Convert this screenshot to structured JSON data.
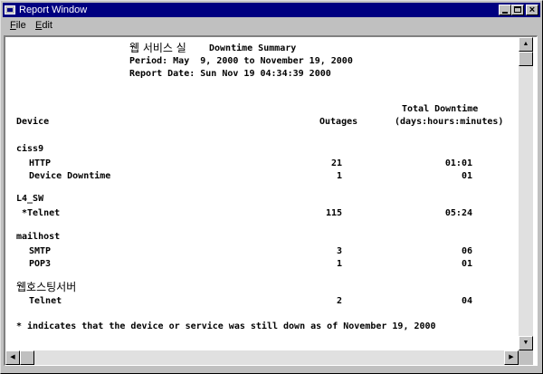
{
  "window": {
    "title": "Report Window"
  },
  "menu": {
    "file": "File",
    "edit": "Edit",
    "file_accel": "F",
    "edit_accel": "E"
  },
  "report": {
    "service_name": "웹 서비스 실",
    "summary_title": "Downtime Summary",
    "period": "Period: May  9, 2000 to November 19, 2000",
    "report_date": "Report Date: Sun Nov 19 04:34:39 2000",
    "header_total": "Total Downtime",
    "header_device": "Device",
    "header_outages": "Outages",
    "header_format": "(days:hours:minutes)",
    "footnote": "* indicates that the device or service was still down as of November 19, 2000",
    "groups": [
      {
        "device": "ciss9",
        "rows": [
          {
            "name": "HTTP",
            "outages": "21",
            "downtime": "01:01"
          },
          {
            "name": "Device Downtime",
            "outages": "1",
            "downtime": "01"
          }
        ]
      },
      {
        "device": "L4_SW",
        "rows": [
          {
            "name": "*Telnet",
            "outages": "115",
            "downtime": "05:24"
          }
        ]
      },
      {
        "device": "mailhost",
        "rows": [
          {
            "name": "SMTP",
            "outages": "3",
            "downtime": "06"
          },
          {
            "name": "POP3",
            "outages": "1",
            "downtime": "01"
          }
        ]
      },
      {
        "device": "웹호스팅서버",
        "rows": [
          {
            "name": "Telnet",
            "outages": "2",
            "downtime": "04"
          }
        ]
      }
    ]
  },
  "icons": {
    "app": "report-app-icon",
    "minimize": "minimize-icon",
    "maximize": "maximize-icon",
    "close": "close-icon"
  },
  "scroll_position": {
    "vertical": 0,
    "horizontal": 0
  },
  "colors": {
    "titlebar": "#000080",
    "face": "#c0c0c0",
    "client": "#ffffff"
  }
}
